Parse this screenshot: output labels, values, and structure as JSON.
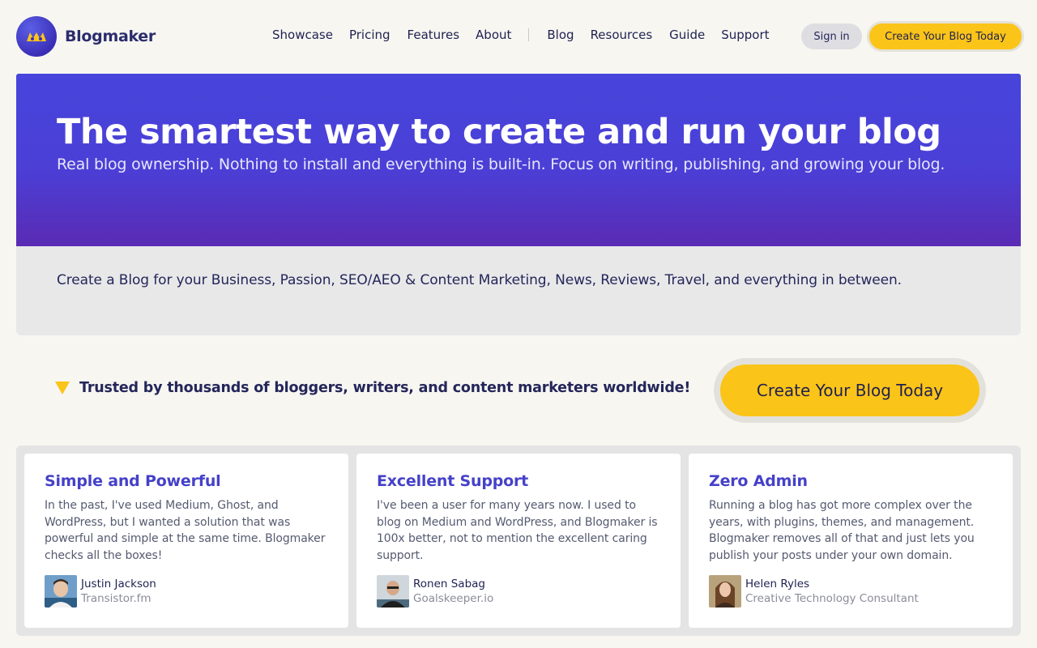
{
  "brand": {
    "name": "Blogmaker"
  },
  "nav": {
    "primary": [
      "Showcase",
      "Pricing",
      "Features",
      "About"
    ],
    "secondary": [
      "Blog",
      "Resources",
      "Guide",
      "Support"
    ]
  },
  "header": {
    "signin_label": "Sign in",
    "cta_label": "Create Your Blog Today"
  },
  "hero": {
    "title": "The smartest way to create and run your blog",
    "subtitle": "Real blog ownership. Nothing to install and everything is built-in. Focus on writing, publishing, and growing your blog."
  },
  "subband": {
    "text": "Create a Blog for your Business, Passion, SEO/AEO & Content Marketing, News, Reviews, Travel, and everything in between."
  },
  "trust": {
    "text": "Trusted by thousands of bloggers, writers, and content marketers worldwide!",
    "cta_label": "Create Your Blog Today"
  },
  "testimonials": [
    {
      "title": "Simple and Powerful",
      "quote": "In the past, I've used Medium, Ghost, and WordPress, but I wanted a solution that was powerful and simple at the same time. Blogmaker checks all the boxes!",
      "name": "Justin Jackson",
      "org": "Transistor.fm"
    },
    {
      "title": "Excellent Support",
      "quote": "I've been a user for many years now. I used to blog on Medium and WordPress, and Blogmaker is 100x better, not to mention the excellent caring support.",
      "name": "Ronen Sabag",
      "org": "Goalskeeper.io"
    },
    {
      "title": "Zero Admin",
      "quote": "Running a blog has got more complex over the years, with plugins, themes, and management. Blogmaker removes all of that and just lets you publish your posts under your own domain.",
      "name": "Helen Ryles",
      "org": "Creative Technology Consultant"
    }
  ],
  "colors": {
    "accent": "#4745dc",
    "cta": "#fbc418",
    "heading": "#4541c9",
    "text": "#1f2150"
  }
}
